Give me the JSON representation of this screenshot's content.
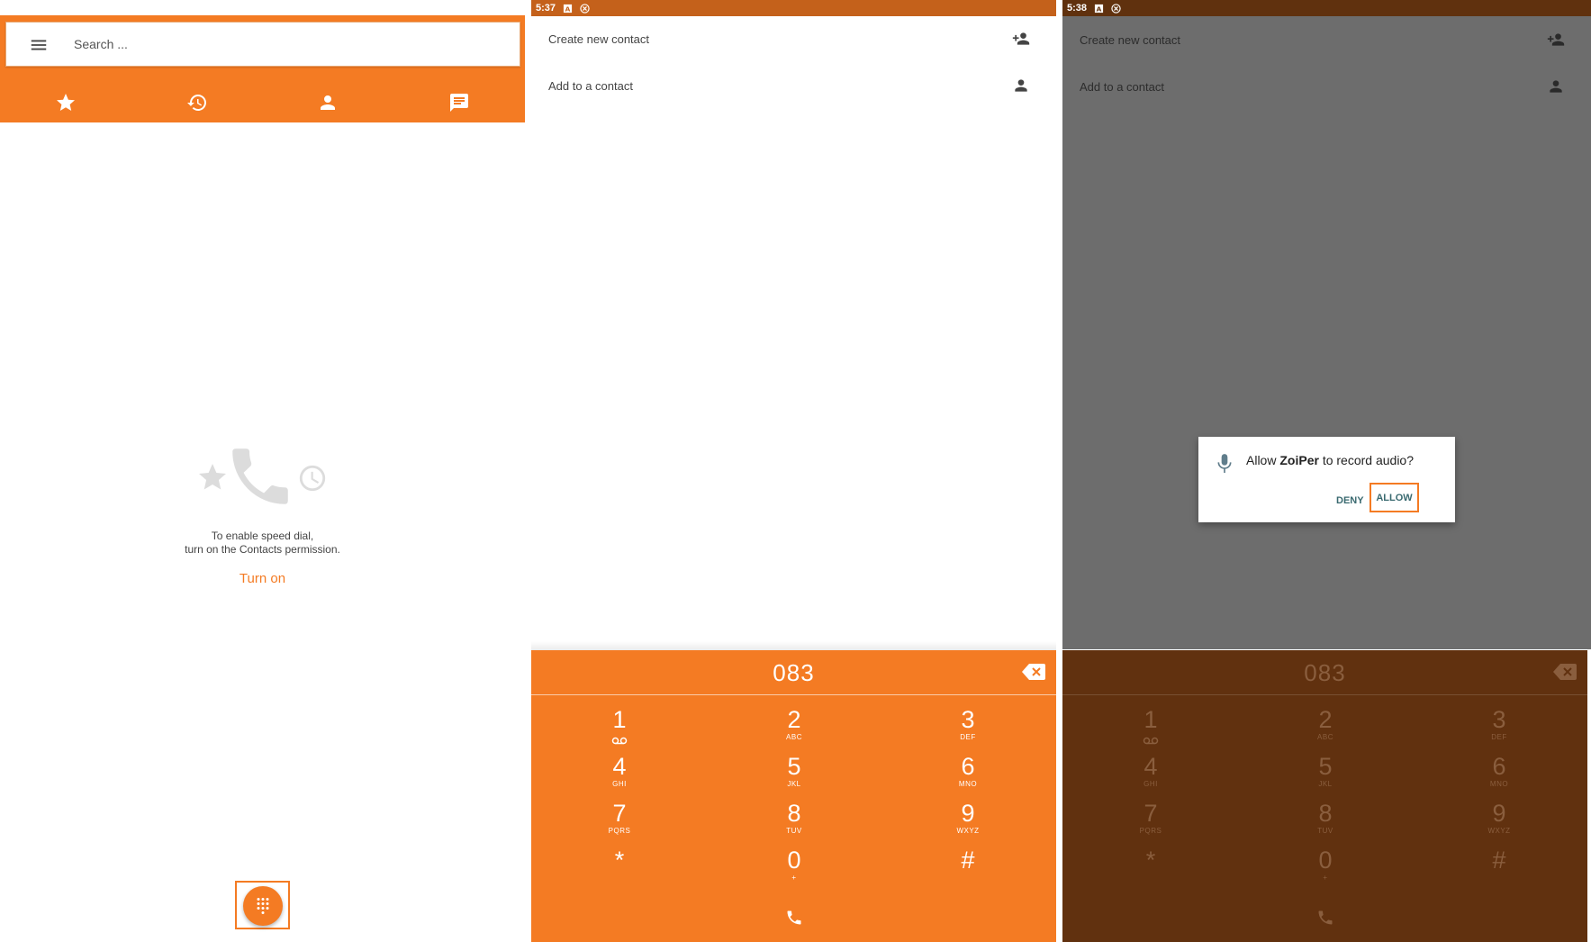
{
  "colors": {
    "accent": "#F47B23",
    "status_bar": "#C4611B",
    "scrim": "#6d6d6d",
    "dimmed_dialpad": "#61310F"
  },
  "panel1": {
    "search": {
      "placeholder": "Search ..."
    },
    "tabs": [
      {
        "icon": "star-icon",
        "active": true
      },
      {
        "icon": "history-icon",
        "active": false
      },
      {
        "icon": "person-icon",
        "active": false
      },
      {
        "icon": "message-icon",
        "active": false
      }
    ],
    "empty_state": {
      "line1": "To enable speed dial,",
      "line2": "turn on the Contacts permission.",
      "action": "Turn on"
    },
    "fab_icon": "dialpad-icon"
  },
  "panel2": {
    "status_time": "5:37",
    "options": [
      {
        "label": "Create new contact",
        "icon": "person-add-icon"
      },
      {
        "label": "Add to a contact",
        "icon": "person-icon"
      }
    ],
    "dialpad": {
      "number": "083",
      "keys": [
        {
          "digit": "1",
          "letters": ""
        },
        {
          "digit": "2",
          "letters": "ABC"
        },
        {
          "digit": "3",
          "letters": "DEF"
        },
        {
          "digit": "4",
          "letters": "GHI"
        },
        {
          "digit": "5",
          "letters": "JKL"
        },
        {
          "digit": "6",
          "letters": "MNO"
        },
        {
          "digit": "7",
          "letters": "PQRS"
        },
        {
          "digit": "8",
          "letters": "TUV"
        },
        {
          "digit": "9",
          "letters": "WXYZ"
        },
        {
          "digit": "*",
          "letters": ""
        },
        {
          "digit": "0",
          "letters": "+"
        },
        {
          "digit": "#",
          "letters": ""
        }
      ]
    }
  },
  "panel3": {
    "status_time": "5:38",
    "options": [
      {
        "label": "Create new contact",
        "icon": "person-add-icon"
      },
      {
        "label": "Add to a contact",
        "icon": "person-icon"
      }
    ],
    "dialog": {
      "prefix": "Allow ",
      "app": "ZoiPer",
      "suffix": " to record audio?",
      "deny": "DENY",
      "allow": "ALLOW"
    },
    "dialpad": {
      "number": "083",
      "keys": [
        {
          "digit": "1",
          "letters": ""
        },
        {
          "digit": "2",
          "letters": "ABC"
        },
        {
          "digit": "3",
          "letters": "DEF"
        },
        {
          "digit": "4",
          "letters": "GHI"
        },
        {
          "digit": "5",
          "letters": "JKL"
        },
        {
          "digit": "6",
          "letters": "MNO"
        },
        {
          "digit": "7",
          "letters": "PQRS"
        },
        {
          "digit": "8",
          "letters": "TUV"
        },
        {
          "digit": "9",
          "letters": "WXYZ"
        },
        {
          "digit": "*",
          "letters": ""
        },
        {
          "digit": "0",
          "letters": "+"
        },
        {
          "digit": "#",
          "letters": ""
        }
      ]
    }
  }
}
